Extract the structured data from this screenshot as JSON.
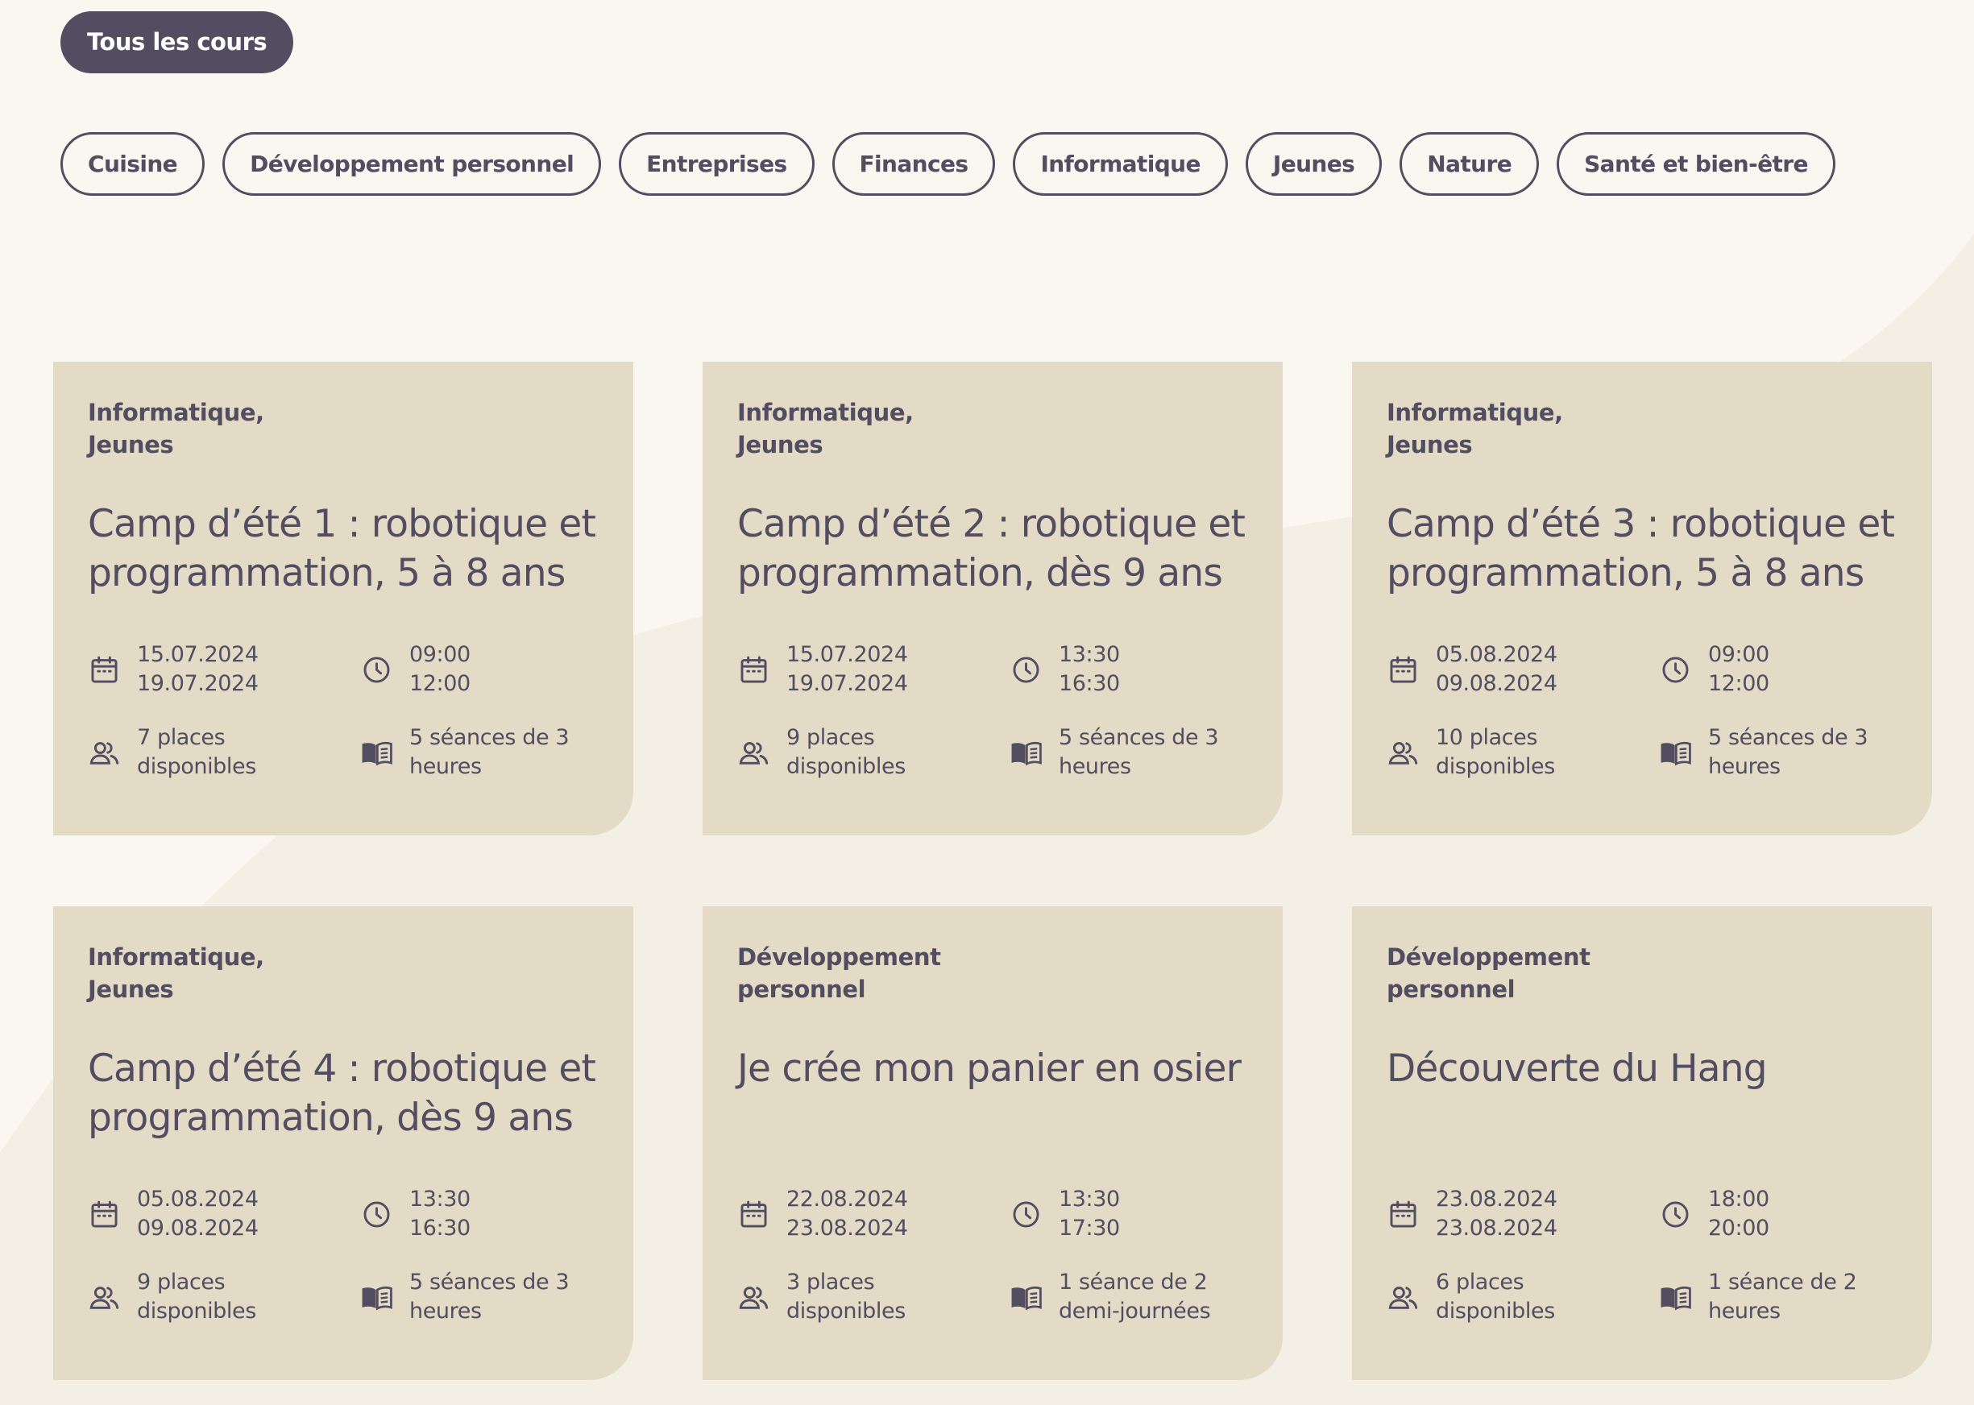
{
  "filters": {
    "all_label": "Tous les cours",
    "categories": [
      "Cuisine",
      "Développement personnel",
      "Entreprises",
      "Finances",
      "Informatique",
      "Jeunes",
      "Nature",
      "Santé et bien-être"
    ]
  },
  "icons": {
    "date": "calendar-icon",
    "time": "clock-icon",
    "places": "people-icon",
    "sessions": "book-icon"
  },
  "colors": {
    "background": "#faf7f1",
    "card": "#e3dbc5",
    "accent": "#524d60"
  },
  "courses": [
    {
      "category_lines": [
        "Informatique,",
        "Jeunes"
      ],
      "title": "Camp d’été 1 : robotique et programmation, 5 à 8 ans",
      "date_start": "15.07.2024",
      "date_end": "19.07.2024",
      "time_start": "09:00",
      "time_end": "12:00",
      "places_line1": "7 places",
      "places_line2": "disponibles",
      "sessions_line1": "5 séances de 3",
      "sessions_line2": "heures"
    },
    {
      "category_lines": [
        "Informatique,",
        "Jeunes"
      ],
      "title": "Camp d’été 2 : robotique et programmation, dès 9 ans",
      "date_start": "15.07.2024",
      "date_end": "19.07.2024",
      "time_start": "13:30",
      "time_end": "16:30",
      "places_line1": "9 places",
      "places_line2": "disponibles",
      "sessions_line1": "5 séances de 3",
      "sessions_line2": "heures"
    },
    {
      "category_lines": [
        "Informatique,",
        "Jeunes"
      ],
      "title": "Camp d’été 3 : robotique et programmation, 5 à 8 ans",
      "date_start": "05.08.2024",
      "date_end": "09.08.2024",
      "time_start": "09:00",
      "time_end": "12:00",
      "places_line1": "10 places",
      "places_line2": "disponibles",
      "sessions_line1": "5 séances de 3",
      "sessions_line2": "heures"
    },
    {
      "category_lines": [
        "Informatique,",
        "Jeunes"
      ],
      "title": "Camp d’été 4 : robotique et programmation, dès 9 ans",
      "date_start": "05.08.2024",
      "date_end": "09.08.2024",
      "time_start": "13:30",
      "time_end": "16:30",
      "places_line1": "9 places",
      "places_line2": "disponibles",
      "sessions_line1": "5 séances de 3",
      "sessions_line2": "heures"
    },
    {
      "category_lines": [
        "Développement",
        "personnel"
      ],
      "title": "Je crée mon panier en osier",
      "date_start": "22.08.2024",
      "date_end": "23.08.2024",
      "time_start": "13:30",
      "time_end": "17:30",
      "places_line1": "3 places",
      "places_line2": "disponibles",
      "sessions_line1": "1 séance de 2",
      "sessions_line2": "demi-journées"
    },
    {
      "category_lines": [
        "Développement",
        "personnel"
      ],
      "title": "Découverte du Hang",
      "date_start": "23.08.2024",
      "date_end": "23.08.2024",
      "time_start": "18:00",
      "time_end": "20:00",
      "places_line1": "6 places",
      "places_line2": "disponibles",
      "sessions_line1": "1 séance de 2",
      "sessions_line2": "heures"
    }
  ]
}
